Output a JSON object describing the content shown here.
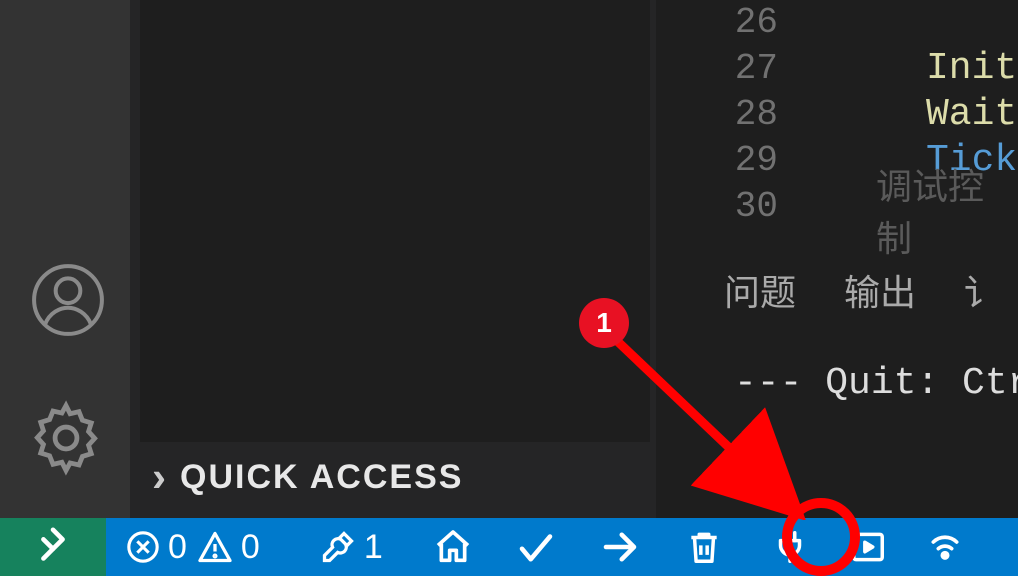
{
  "sidebar": {
    "quick_access_label": "QUICK ACCESS"
  },
  "editor": {
    "line_numbers": [
      "26",
      "27",
      "28",
      "29",
      "30"
    ],
    "code_lines": [
      {
        "text": ""
      },
      {
        "text": "InitS",
        "class": "fn-yellow"
      },
      {
        "text": "WaitF",
        "class": "fn-yellow"
      },
      {
        "text": "Ticke",
        "class": "fn-blue"
      },
      {
        "text": ""
      }
    ],
    "ghost_label": "调试控制"
  },
  "panel": {
    "tab_problems": "问题",
    "tab_output": "输出",
    "tab_more": "讠",
    "terminal_line": "--- Quit: Ctr"
  },
  "status": {
    "errors": "0",
    "warnings": "0",
    "tools": "1"
  },
  "annotation": {
    "badge": "1"
  }
}
